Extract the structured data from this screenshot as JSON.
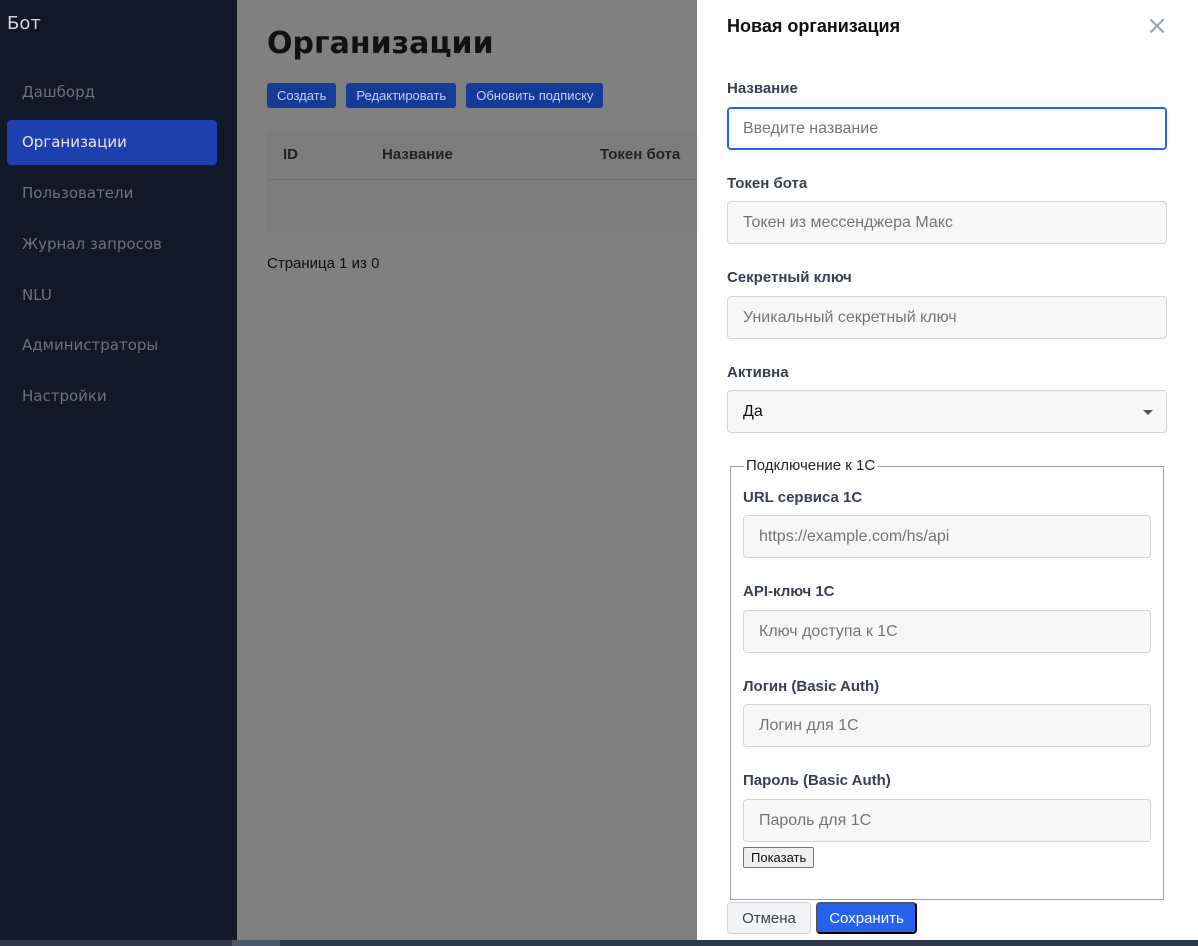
{
  "sidebar": {
    "brand": "Бот",
    "items": [
      {
        "label": "Дашборд"
      },
      {
        "label": "Организации",
        "active": true
      },
      {
        "label": "Пользователи"
      },
      {
        "label": "Журнал запросов"
      },
      {
        "label": "NLU"
      },
      {
        "label": "Администраторы"
      },
      {
        "label": "Настройки"
      }
    ]
  },
  "main": {
    "title": "Организации",
    "toolbar": {
      "create_label": "Создать",
      "edit_label": "Редактировать",
      "update_sub_label": "Обновить подписку"
    },
    "table": {
      "columns": [
        "ID",
        "Название",
        "Токен бота"
      ]
    },
    "pager": "Страница 1 из 0"
  },
  "drawer": {
    "title": "Новая организация",
    "close_icon": "×",
    "fields": {
      "name": {
        "label": "Название",
        "placeholder": "Введите название",
        "value": ""
      },
      "token": {
        "label": "Токен бота",
        "placeholder": "Токен из мессенджера Макс",
        "value": ""
      },
      "secret": {
        "label": "Секретный ключ",
        "placeholder": "Уникальный секретный ключ",
        "value": ""
      },
      "active": {
        "label": "Активна",
        "value": "Да"
      }
    },
    "onec": {
      "legend": "Подключение к 1С",
      "url": {
        "label": "URL сервиса 1С",
        "placeholder": "https://example.com/hs/api"
      },
      "api_key": {
        "label": "API-ключ 1С",
        "placeholder": "Ключ доступа к 1С"
      },
      "login": {
        "label": "Логин (Basic Auth)",
        "placeholder": "Логин для 1С"
      },
      "password": {
        "label": "Пароль (Basic Auth)",
        "placeholder": "Пароль для 1С"
      },
      "show_label": "Показать"
    },
    "cancel_label": "Отмена",
    "save_label": "Сохранить"
  },
  "colors": {
    "sidebar_bg": "#111827",
    "accent": "#2563eb",
    "active_nav": "#1e40af"
  }
}
